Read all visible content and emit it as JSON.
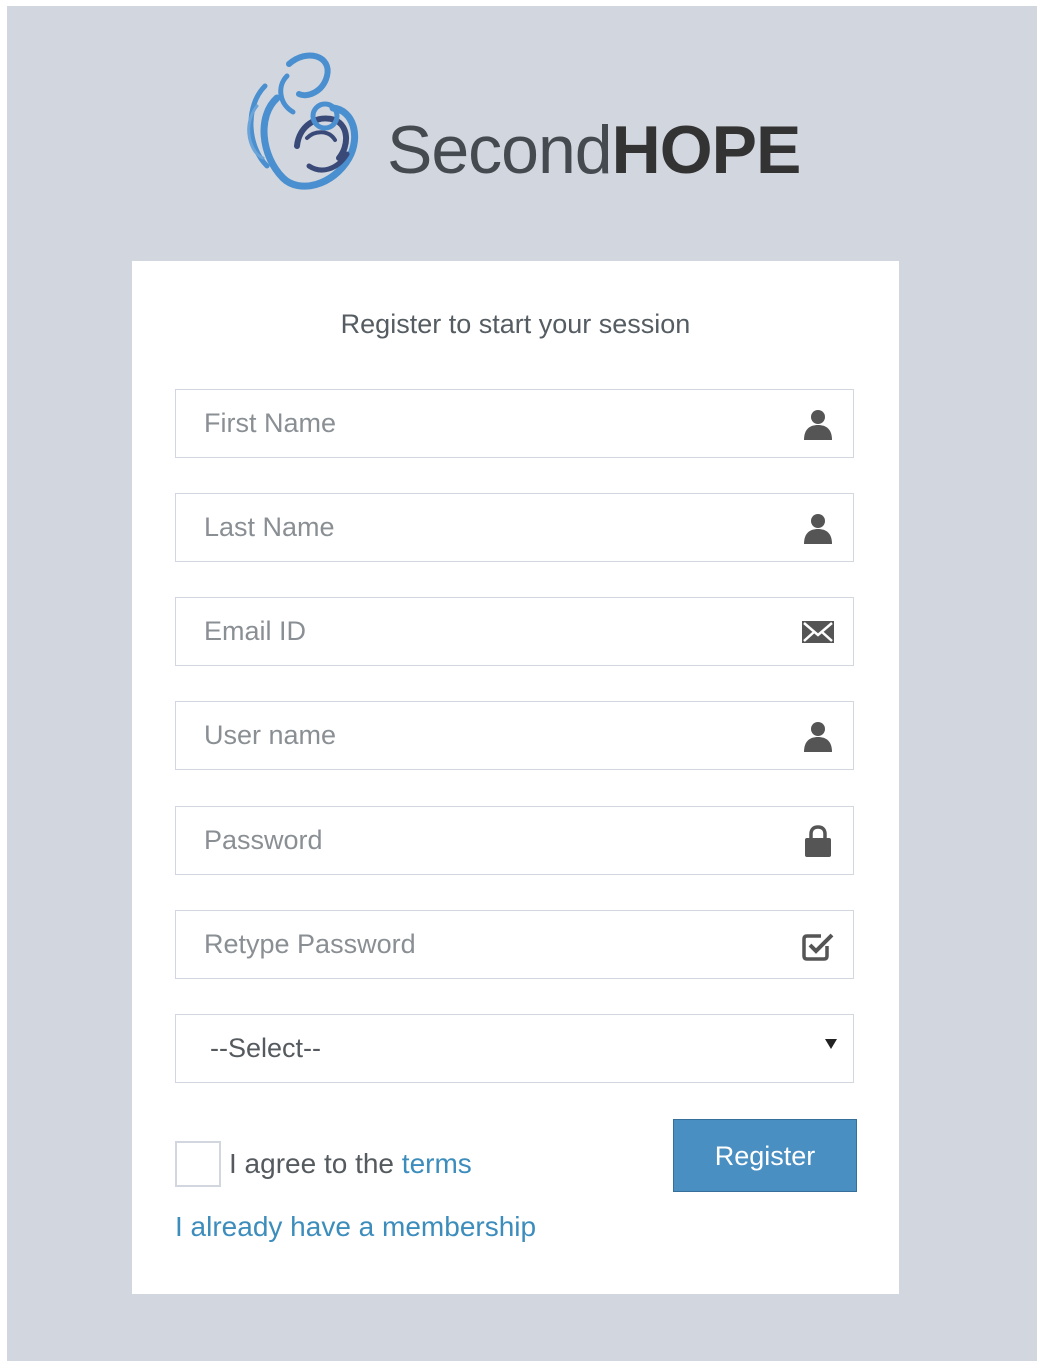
{
  "brand": {
    "name_light": "Second",
    "name_bold": "HOPE",
    "logo_icon": "mother-child-logo-icon",
    "colors": {
      "logo_blue": "#4a8fcf",
      "logo_navy": "#3a4a78",
      "text": "#333a40"
    }
  },
  "form": {
    "title": "Register to start your session",
    "fields": [
      {
        "placeholder": "First Name",
        "value": "",
        "icon": "user-icon"
      },
      {
        "placeholder": "Last Name",
        "value": "",
        "icon": "user-icon"
      },
      {
        "placeholder": "Email ID",
        "value": "",
        "icon": "envelope-icon"
      },
      {
        "placeholder": "User name",
        "value": "",
        "icon": "user-icon"
      },
      {
        "placeholder": "Password",
        "value": "",
        "icon": "lock-icon"
      },
      {
        "placeholder": "Retype Password",
        "value": "",
        "icon": "check-square-icon"
      }
    ],
    "select": {
      "selected": "--Select--",
      "icon": "caret-down-icon"
    },
    "agree_prefix": "I agree to the",
    "terms_link": "terms",
    "agree_checked": false,
    "register_label": "Register",
    "membership_link": "I already have a membership",
    "colors": {
      "button": "#4a8fc2",
      "link": "#3c8dbc",
      "background": "#d2d6de",
      "card": "#ffffff"
    }
  }
}
